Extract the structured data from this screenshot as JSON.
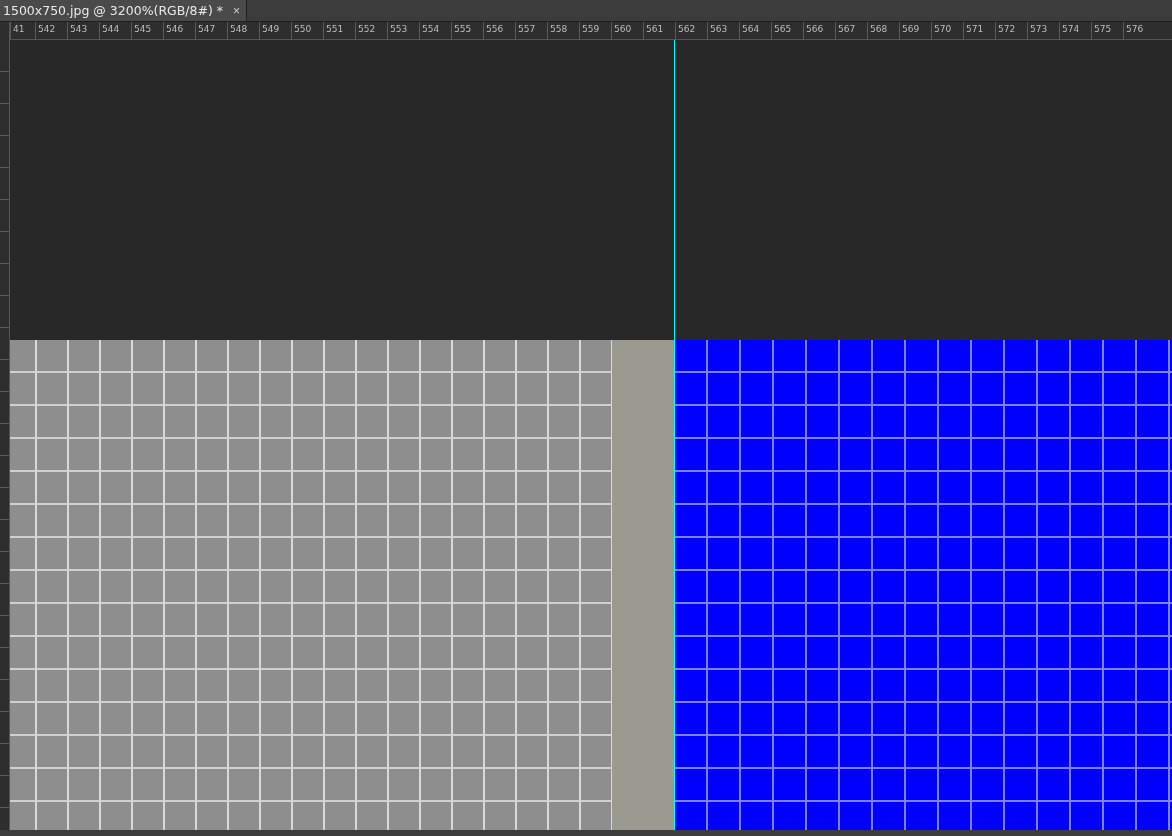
{
  "document_tab": {
    "title": "1500x750.jpg @ 3200%(RGB/8#) *",
    "close": "×",
    "selected": true
  },
  "top_ruler": {
    "labels": [
      "41",
      "542",
      "543",
      "544",
      "545",
      "546",
      "547",
      "548",
      "549",
      "550",
      "551",
      "552",
      "553",
      "554",
      "555",
      "556",
      "557",
      "558",
      "559",
      "560",
      "561",
      "562",
      "563",
      "564",
      "565",
      "566",
      "567",
      "568",
      "569",
      "570",
      "571",
      "572",
      "573",
      "574",
      "575",
      "576"
    ]
  }
}
